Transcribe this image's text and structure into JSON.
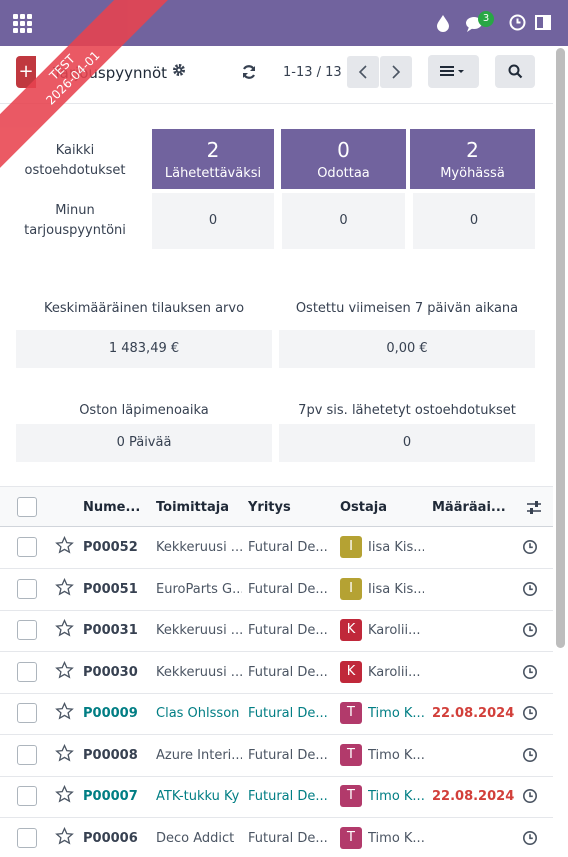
{
  "env_ribbon": {
    "line1": "TEST",
    "line2": "2026-04-01"
  },
  "topbar": {
    "chat_count": "3",
    "icons": [
      "apps-icon",
      "drop-icon",
      "chat-icon",
      "clock-icon",
      "panel-icon"
    ]
  },
  "control": {
    "new_label": "+",
    "title": "Tarjouspyynnöt",
    "pager": "1-13 / 13"
  },
  "dashboard": {
    "row_labels": [
      "Kaikki ostoehdotukset",
      "Minun tarjouspyyntöni"
    ],
    "tiles": [
      {
        "value": "2",
        "label": "Lähetettäväksi"
      },
      {
        "value": "0",
        "label": "Odottaa"
      },
      {
        "value": "2",
        "label": "Myöhässä"
      }
    ],
    "mine": [
      "0",
      "0",
      "0"
    ],
    "stats": [
      {
        "label": "Keskimääräinen tilauksen arvo",
        "value": "1 483,49 €"
      },
      {
        "label": "Ostettu viimeisen 7 päivän aikana",
        "value": "0,00 €"
      },
      {
        "label": "Oston läpimenoaika",
        "value": "0 Päivää"
      },
      {
        "label": "7pv sis. lähetetyt ostoehdotukset",
        "value": "0"
      }
    ]
  },
  "table": {
    "headers": [
      "Nume...",
      "Toimittaja",
      "Yritys",
      "Ostaja",
      "Määräai..."
    ],
    "rows": [
      {
        "num": "P00052",
        "vendor": "Kekkeruusi ...",
        "company": "Futural De...",
        "buyer_initial": "I",
        "buyer": "Iisa Kis...",
        "deadline": "",
        "highlight": false,
        "color": "#b5a233"
      },
      {
        "num": "P00051",
        "vendor": "EuroParts G...",
        "company": "Futural De...",
        "buyer_initial": "I",
        "buyer": "Iisa Kis...",
        "deadline": "",
        "highlight": false,
        "color": "#b5a233"
      },
      {
        "num": "P00031",
        "vendor": "Kekkeruusi ...",
        "company": "Futural De...",
        "buyer_initial": "K",
        "buyer": "Karolii...",
        "deadline": "",
        "highlight": false,
        "color": "#c0283a"
      },
      {
        "num": "P00030",
        "vendor": "Kekkeruusi ...",
        "company": "Futural De...",
        "buyer_initial": "K",
        "buyer": "Karolii...",
        "deadline": "",
        "highlight": false,
        "color": "#c0283a"
      },
      {
        "num": "P00009",
        "vendor": "Clas Ohlsson",
        "company": "Futural De...",
        "buyer_initial": "T",
        "buyer": "Timo K...",
        "deadline": "22.08.2024",
        "highlight": true,
        "color": "#b23a6b"
      },
      {
        "num": "P00008",
        "vendor": "Azure Interi...",
        "company": "Futural De...",
        "buyer_initial": "T",
        "buyer": "Timo K...",
        "deadline": "",
        "highlight": false,
        "color": "#b23a6b"
      },
      {
        "num": "P00007",
        "vendor": "ATK-tukku Ky",
        "company": "Futural De...",
        "buyer_initial": "T",
        "buyer": "Timo K...",
        "deadline": "22.08.2024",
        "highlight": true,
        "color": "#b23a6b"
      },
      {
        "num": "P00006",
        "vendor": "Deco Addict",
        "company": "Futural De...",
        "buyer_initial": "T",
        "buyer": "Timo K...",
        "deadline": "",
        "highlight": false,
        "color": "#b23a6b"
      }
    ]
  },
  "colors": {
    "brand": "#71639e",
    "link": "#017e84",
    "danger": "#d23f3a"
  }
}
